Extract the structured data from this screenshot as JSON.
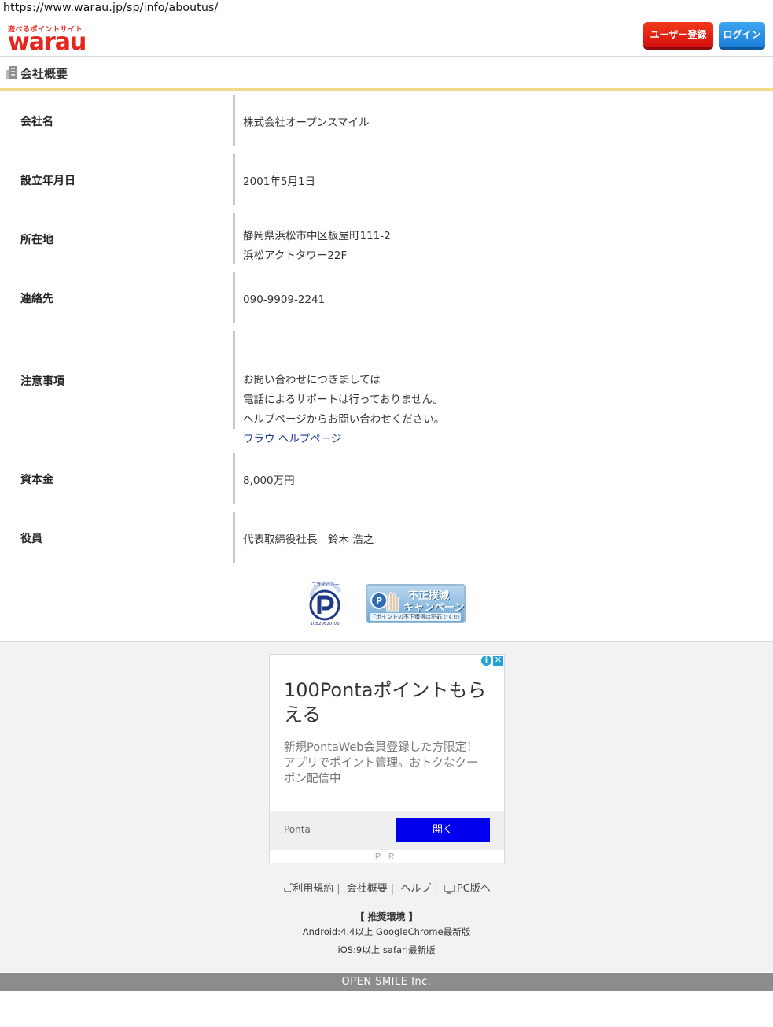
{
  "url": "https://www.warau.jp/sp/info/aboutus/",
  "header": {
    "logo_tagline": "遊べるポイントサイト",
    "logo_word": "warau",
    "register_label": "ユーザー登録",
    "login_label": "ログイン"
  },
  "section": {
    "title": "会社概要"
  },
  "company_info": [
    {
      "label": "会社名",
      "lines": [
        "株式会社オープンスマイル"
      ]
    },
    {
      "label": "設立年月日",
      "lines": [
        "2001年5月1日"
      ]
    },
    {
      "label": "所在地",
      "lines": [
        "静岡県浜松市中区板屋町111-2",
        "浜松アクトタワー22F"
      ]
    },
    {
      "label": "連絡先",
      "lines": [
        "090-9909-2241"
      ]
    },
    {
      "label": "注意事項",
      "lines": [
        "お問い合わせにつきましては",
        "電話によるサポートは行っておりません。",
        "ヘルプページからお問い合わせください。"
      ],
      "link": "ワラウ ヘルプページ"
    },
    {
      "label": "資本金",
      "lines": [
        "8,000万円"
      ]
    },
    {
      "label": "役員",
      "lines": [
        "代表取締役社長　鈴木 浩之"
      ]
    }
  ],
  "badges": {
    "privacy_mark_text": "プライバシー",
    "privacy_number": "10820620(06)",
    "campaign_line1": "不正撲滅",
    "campaign_line2": "キャンペーン",
    "campaign_line3": "「ポイントの不正獲得は犯罪です!!」"
  },
  "ad": {
    "headline": "100Pontaポイントもらえる",
    "description": "新規PontaWeb会員登録した方限定！アプリでポイント管理。おトクなクーポン配信中",
    "advertiser": "Ponta",
    "cta": "開く",
    "pr_label": "ＰＲ",
    "info_glyph": "i",
    "close_glyph": "✕"
  },
  "footer": {
    "links": [
      "ご利用規約",
      "会社概要",
      "ヘルプ",
      "PC版へ"
    ],
    "separator": "|",
    "env_title": "【 推奨環境 】",
    "env_android": "Android:4.4以上 GoogleChrome最新版",
    "env_ios": "iOS:9以上 safari最新版",
    "copyright": "OPEN SMILE Inc."
  },
  "colors": {
    "brand_red": "#e8251e",
    "register_button": "#e01e16",
    "login_button": "#2a90e6",
    "section_underline": "#f0d98a",
    "ad_button": "#0000ee",
    "copyright_bar": "#8c8c8c"
  },
  "icons": {
    "section": "building-icon",
    "pc_link": "monitor-icon",
    "ad_info": "info-icon",
    "ad_close": "close-icon"
  }
}
